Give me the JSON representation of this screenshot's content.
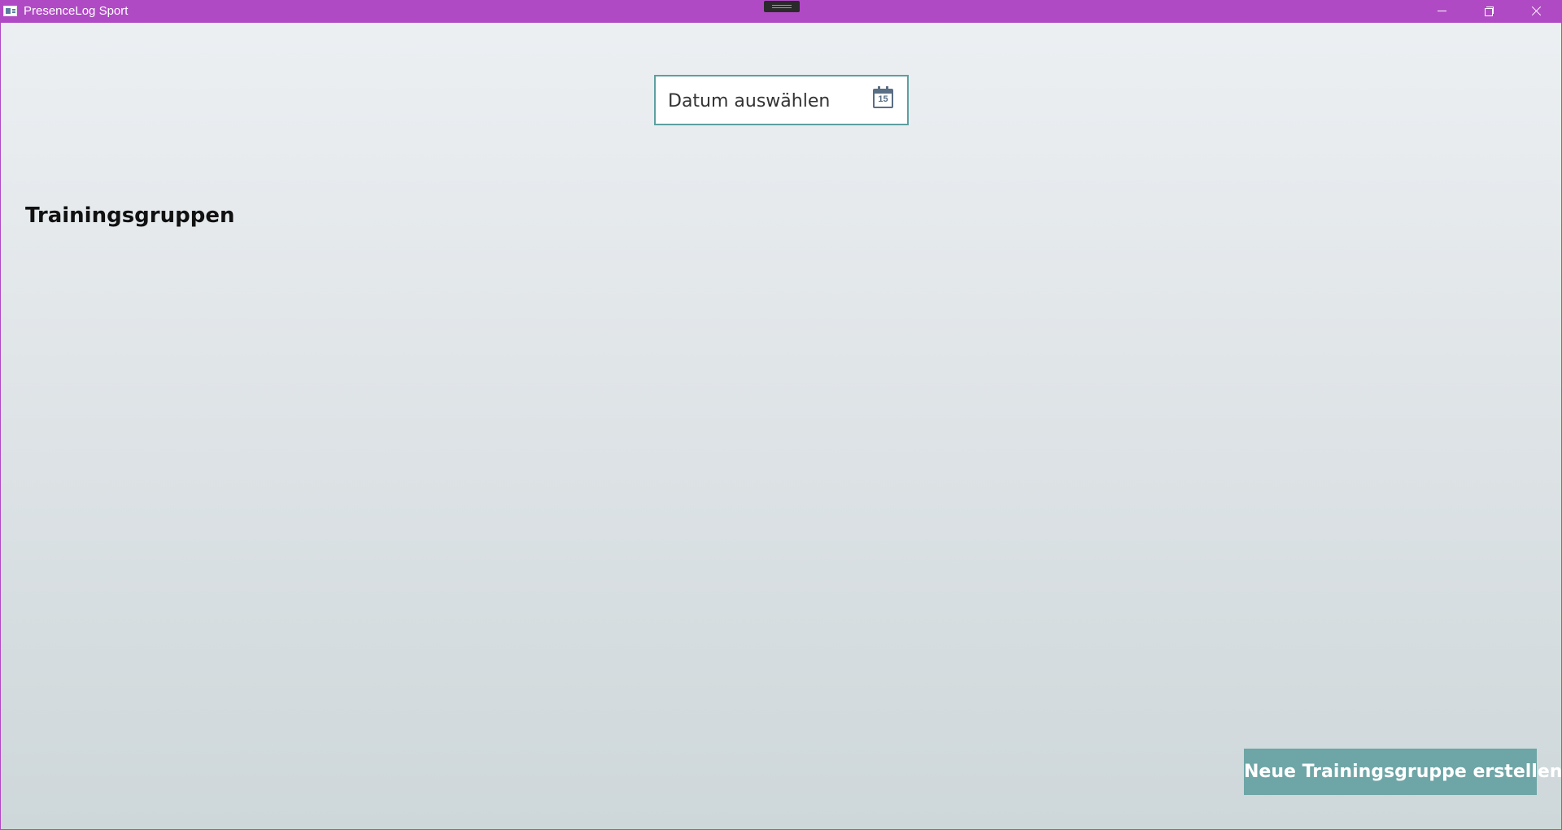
{
  "window": {
    "title": "PresenceLog Sport",
    "titlebar_color": "#b04ac4",
    "app_icon": "app-window-icon",
    "controls": [
      "minimize-icon",
      "restore-icon",
      "close-icon"
    ]
  },
  "date_picker": {
    "placeholder": "Datum auswählen",
    "icon": "calendar-icon",
    "icon_day": "15",
    "border_color": "#5e9fa0"
  },
  "main": {
    "section_title": "Trainingsgruppen"
  },
  "actions": {
    "create_group_label": "Neue Trainingsgruppe erstellen",
    "accent_color": "#6ea5a6"
  }
}
